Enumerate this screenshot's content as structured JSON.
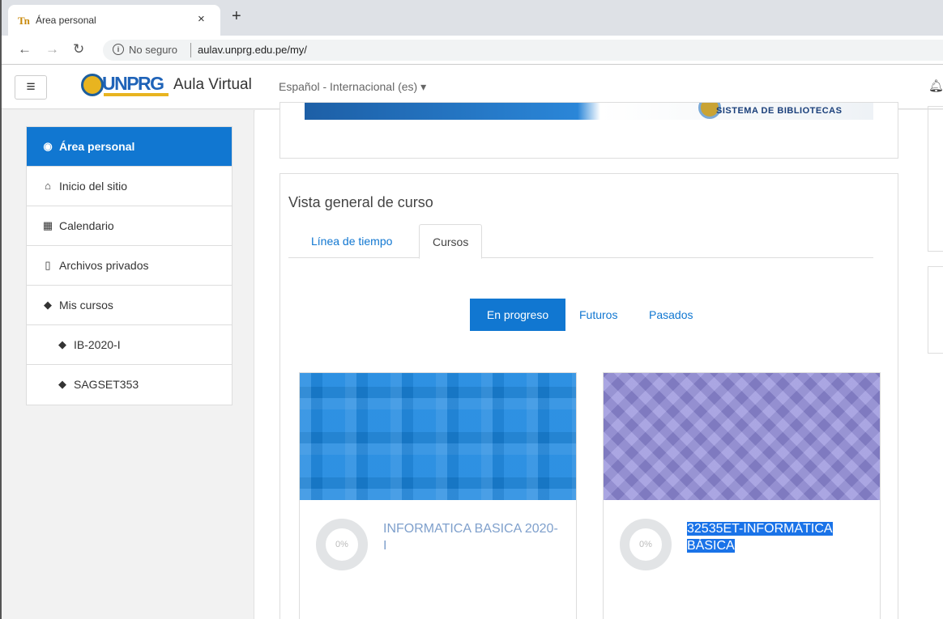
{
  "browser": {
    "tab_title": "Área personal",
    "favicon_text": "Tn",
    "close_glyph": "×",
    "new_tab_glyph": "+",
    "security_label": "No seguro",
    "url": "aulav.unprg.edu.pe/my/"
  },
  "navbar": {
    "logo_text": "UNPRG",
    "site_name": "Aula Virtual",
    "language": "Español - Internacional (es) ▾",
    "icons": [
      "hamburger-icon",
      "bell-icon"
    ]
  },
  "drawer": {
    "items": [
      {
        "label": "Área personal",
        "icon": "dashboard-icon",
        "glyph": "◉",
        "active": true
      },
      {
        "label": "Inicio del sitio",
        "icon": "home-icon",
        "glyph": "⌂"
      },
      {
        "label": "Calendario",
        "icon": "calendar-icon",
        "glyph": "▦"
      },
      {
        "label": "Archivos privados",
        "icon": "file-icon",
        "glyph": "▯"
      },
      {
        "label": "Mis cursos",
        "icon": "graduation-cap-icon",
        "glyph": "◆"
      },
      {
        "label": "IB-2020-I",
        "icon": "graduation-cap-icon",
        "glyph": "◆"
      },
      {
        "label": "SAGSET353",
        "icon": "graduation-cap-icon",
        "glyph": "◆"
      }
    ]
  },
  "banner": {
    "text": "SISTEMA DE BIBLIOTECAS"
  },
  "course_overview": {
    "title": "Vista general de curso",
    "tabs": [
      "Línea de tiempo",
      "Cursos"
    ],
    "active_tab": "Cursos",
    "filters": [
      "En progreso",
      "Futuros",
      "Pasados"
    ],
    "active_filter": "En progreso",
    "courses": [
      {
        "name": "INFORMATICA BASICA 2020-I",
        "progress_label": "0%",
        "progress": 0
      },
      {
        "name": "32535ET-INFORMÁTICA BÁSICA",
        "progress_label": "0%",
        "progress": 0,
        "selected": true
      }
    ]
  },
  "colors": {
    "primary": "#1177d1",
    "link": "#7fa0cc",
    "selection": "#1a73e8"
  }
}
